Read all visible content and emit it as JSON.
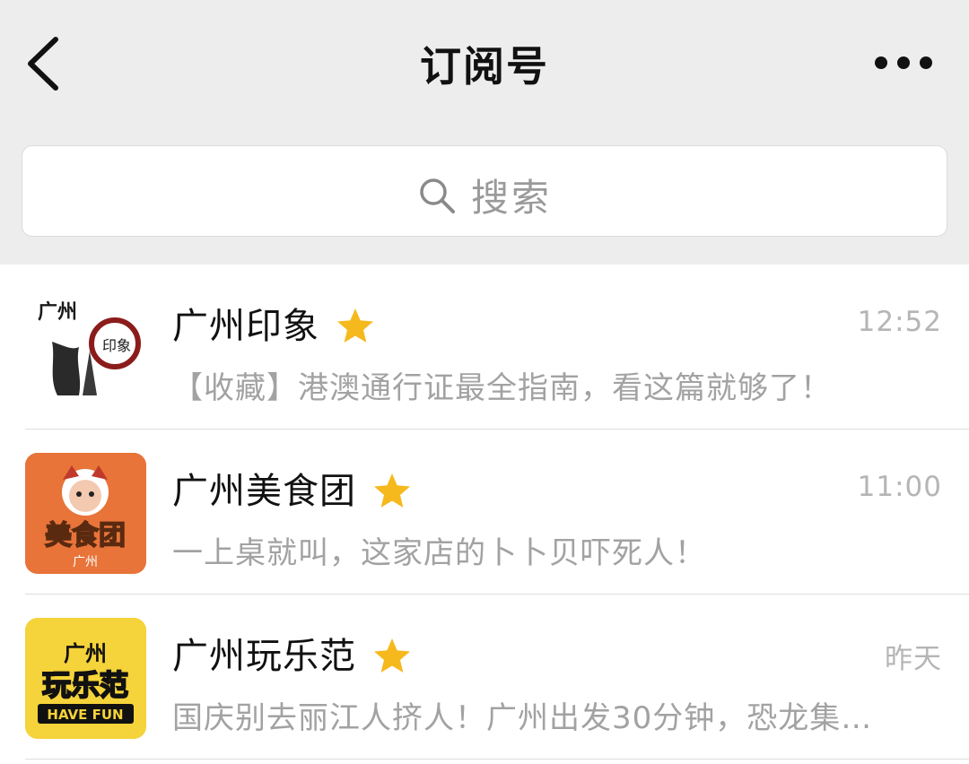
{
  "nav": {
    "title": "订阅号",
    "back_icon": "chevron-left-icon",
    "more_icon": "more-horizontal-icon"
  },
  "search": {
    "placeholder": "搜索",
    "icon": "search-icon"
  },
  "subscriptions": [
    {
      "name": "广州印象",
      "starred": true,
      "time": "12:52",
      "preview": "【收藏】港澳通行证最全指南，看这篇就够了！",
      "avatar": {
        "lines": [
          "广州",
          "印象"
        ],
        "bg": "#ffffff",
        "fg": "#1a1a1a",
        "accent": "#8b1c1c"
      }
    },
    {
      "name": "广州美食团",
      "starred": true,
      "time": "11:00",
      "preview": "一上桌就叫，这家店的卜卜贝吓死人！",
      "avatar": {
        "lines": [
          "美食团",
          "广州"
        ],
        "bg": "#e8743a",
        "fg": "#ffffff"
      }
    },
    {
      "name": "广州玩乐范",
      "starred": true,
      "time": "昨天",
      "preview": "国庆别去丽江人挤人！广州出发30分钟，恐龙集…",
      "avatar": {
        "lines": [
          "广州",
          "玩乐范",
          "HAVE FUN"
        ],
        "bg": "#f5d33a",
        "fg": "#111111"
      }
    }
  ],
  "colors": {
    "background": "#ededed",
    "list_background": "#ffffff",
    "star": "#f6b91d",
    "muted_text": "#a2a2a2"
  }
}
